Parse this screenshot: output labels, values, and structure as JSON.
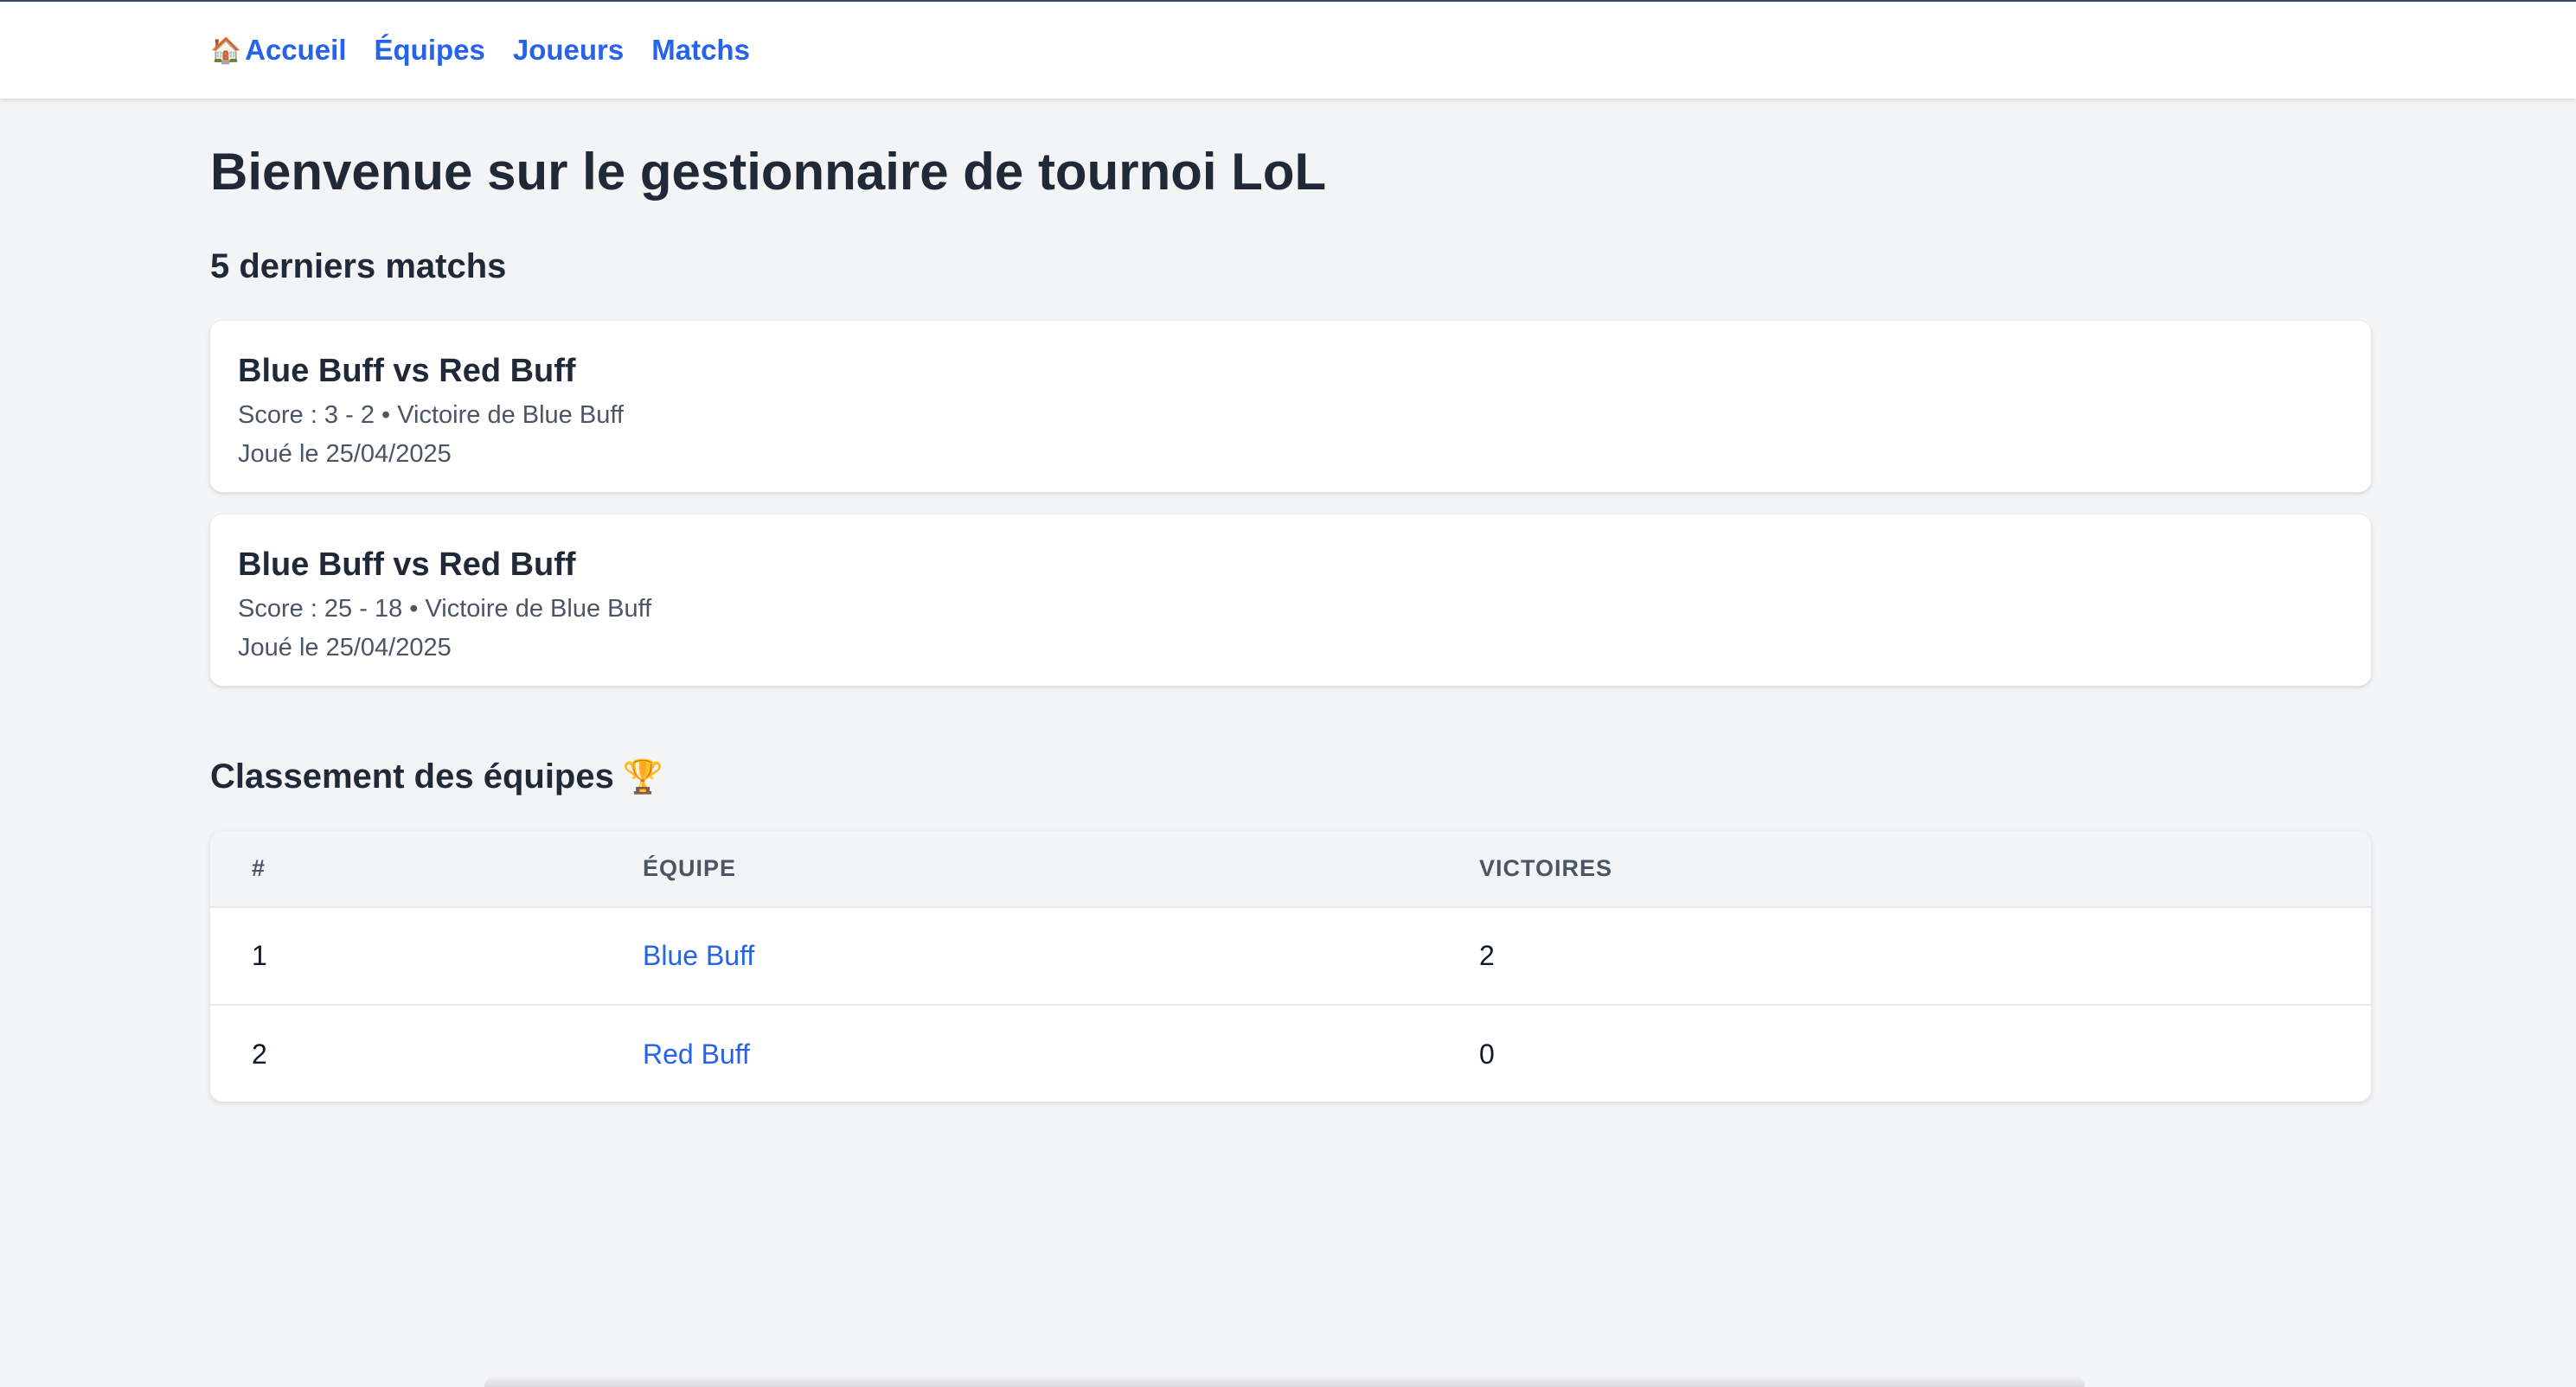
{
  "nav": {
    "home_icon": "house-icon",
    "items": [
      {
        "label": "Accueil"
      },
      {
        "label": "Équipes"
      },
      {
        "label": "Joueurs"
      },
      {
        "label": "Matchs"
      }
    ]
  },
  "page_title": "Bienvenue sur le gestionnaire de tournoi LoL",
  "recent_matches": {
    "title": "5 derniers matchs",
    "matches": [
      {
        "title": "Blue Buff vs Red Buff",
        "score": "Score : 3 - 2 • Victoire de Blue Buff",
        "date": "Joué le 25/04/2025"
      },
      {
        "title": "Blue Buff vs Red Buff",
        "score": "Score : 25 - 18 • Victoire de Blue Buff",
        "date": "Joué le 25/04/2025"
      }
    ]
  },
  "ranking": {
    "title": "Classement des équipes",
    "trophy": "🏆",
    "headers": {
      "rank": "#",
      "team": "ÉQUIPE",
      "wins": "VICTOIRES"
    },
    "rows": [
      {
        "rank": "1",
        "team": "Blue Buff",
        "wins": "2"
      },
      {
        "rank": "2",
        "team": "Red Buff",
        "wins": "0"
      }
    ]
  },
  "colors": {
    "link": "#2563eb",
    "background": "#f3f4f6",
    "text": "#1f2937"
  }
}
